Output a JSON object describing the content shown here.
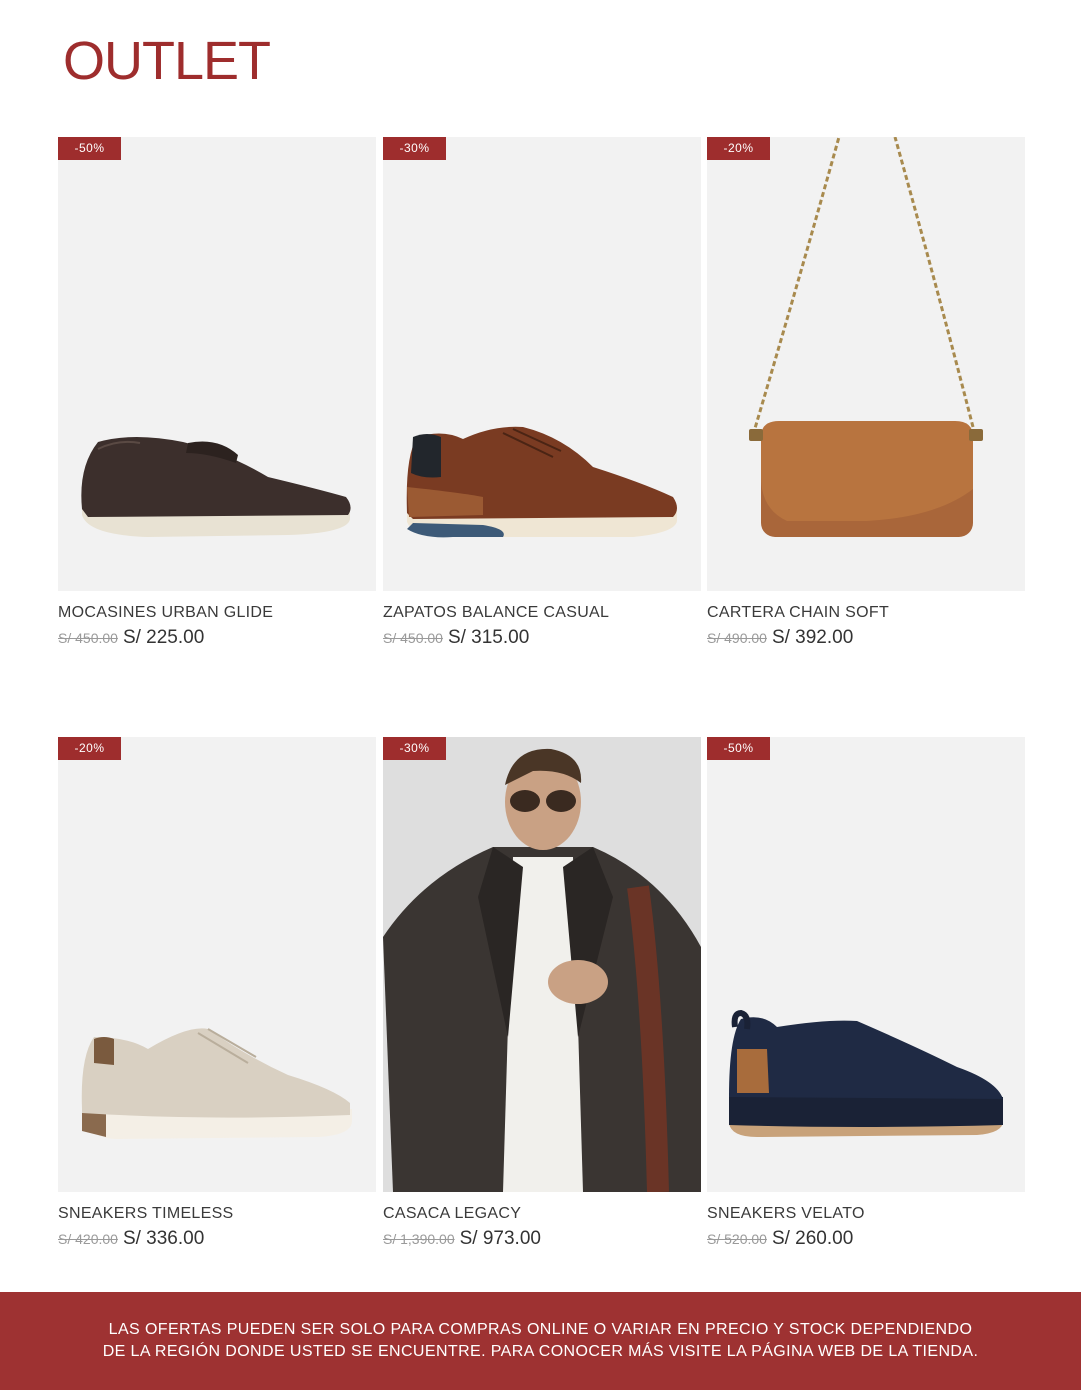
{
  "page": {
    "title": "OUTLET"
  },
  "products": [
    {
      "badge": "-50%",
      "name": "MOCASINES URBAN GLIDE",
      "old_price": "S/ 450.00",
      "new_price": "S/ 225.00"
    },
    {
      "badge": "-30%",
      "name": "ZAPATOS BALANCE CASUAL",
      "old_price": "S/ 450.00",
      "new_price": "S/ 315.00"
    },
    {
      "badge": "-20%",
      "name": "CARTERA CHAIN SOFT",
      "old_price": "S/ 490.00",
      "new_price": "S/ 392.00"
    },
    {
      "badge": "-20%",
      "name": "SNEAKERS TIMELESS",
      "old_price": "S/ 420.00",
      "new_price": "S/ 336.00"
    },
    {
      "badge": "-30%",
      "name": "CASACA LEGACY",
      "old_price": "S/ 1,390.00",
      "new_price": "S/ 973.00"
    },
    {
      "badge": "-50%",
      "name": "SNEAKERS VELATO",
      "old_price": "S/ 520.00",
      "new_price": "S/ 260.00"
    }
  ],
  "footer": {
    "line1": "LAS OFERTAS PUEDEN SER SOLO PARA COMPRAS ONLINE O VARIAR EN PRECIO Y STOCK DEPENDIENDO",
    "line2": "DE LA REGIÓN DONDE USTED SE ENCUENTRE. PARA CONOCER MÁS VISITE LA PÁGINA WEB DE LA TIENDA."
  },
  "colors": {
    "brand": "#9e2d2d",
    "image_bg": "#f2f2f2"
  }
}
